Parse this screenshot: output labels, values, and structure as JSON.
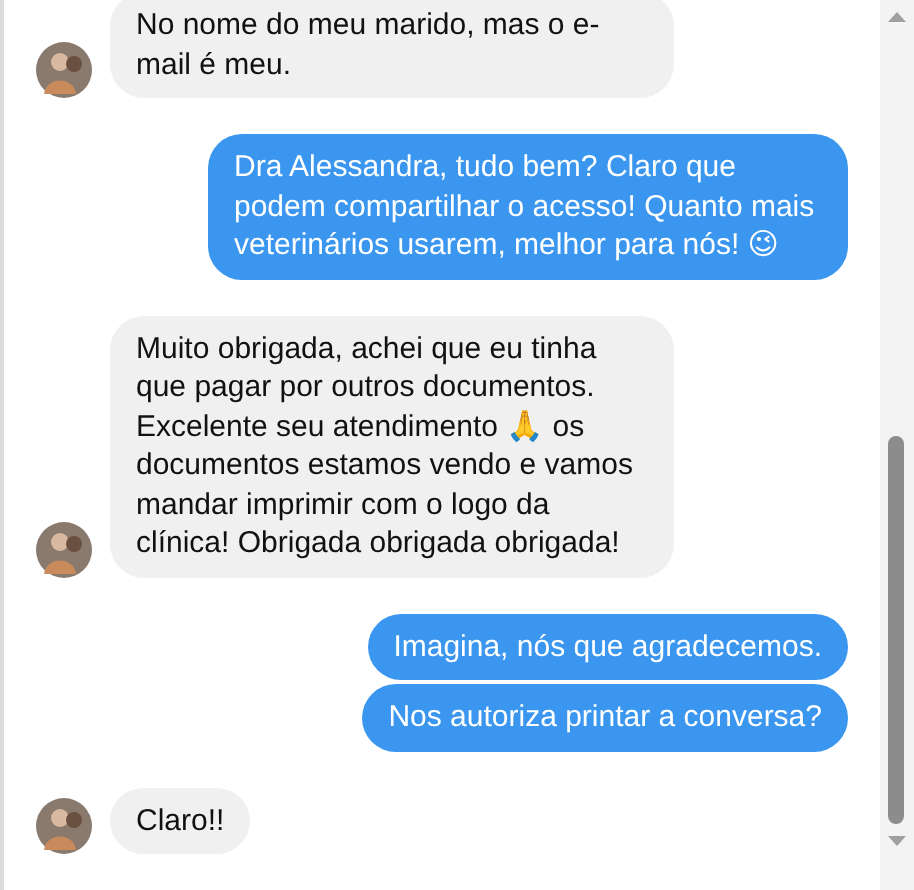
{
  "groups": [
    {
      "outgoing": false,
      "messages": [
        "No nome do meu marido, mas o e-mail é meu."
      ]
    },
    {
      "outgoing": true,
      "messages": [
        "Dra Alessandra, tudo bem? Claro que podem compartilhar o acesso! Quanto mais veterinários usarem, melhor para nós! 😉"
      ]
    },
    {
      "outgoing": false,
      "messages": [
        "Muito obrigada, achei que eu tinha que pagar por outros documentos. Excelente seu atendimento 🙏 os documentos estamos vendo e vamos mandar imprimir com o logo da clínica! Obrigada obrigada obrigada!"
      ]
    },
    {
      "outgoing": true,
      "messages": [
        "Imagina, nós que agradecemos.",
        "Nos autoriza printar a conversa?"
      ]
    },
    {
      "outgoing": false,
      "messages": [
        "Claro!!"
      ]
    }
  ]
}
